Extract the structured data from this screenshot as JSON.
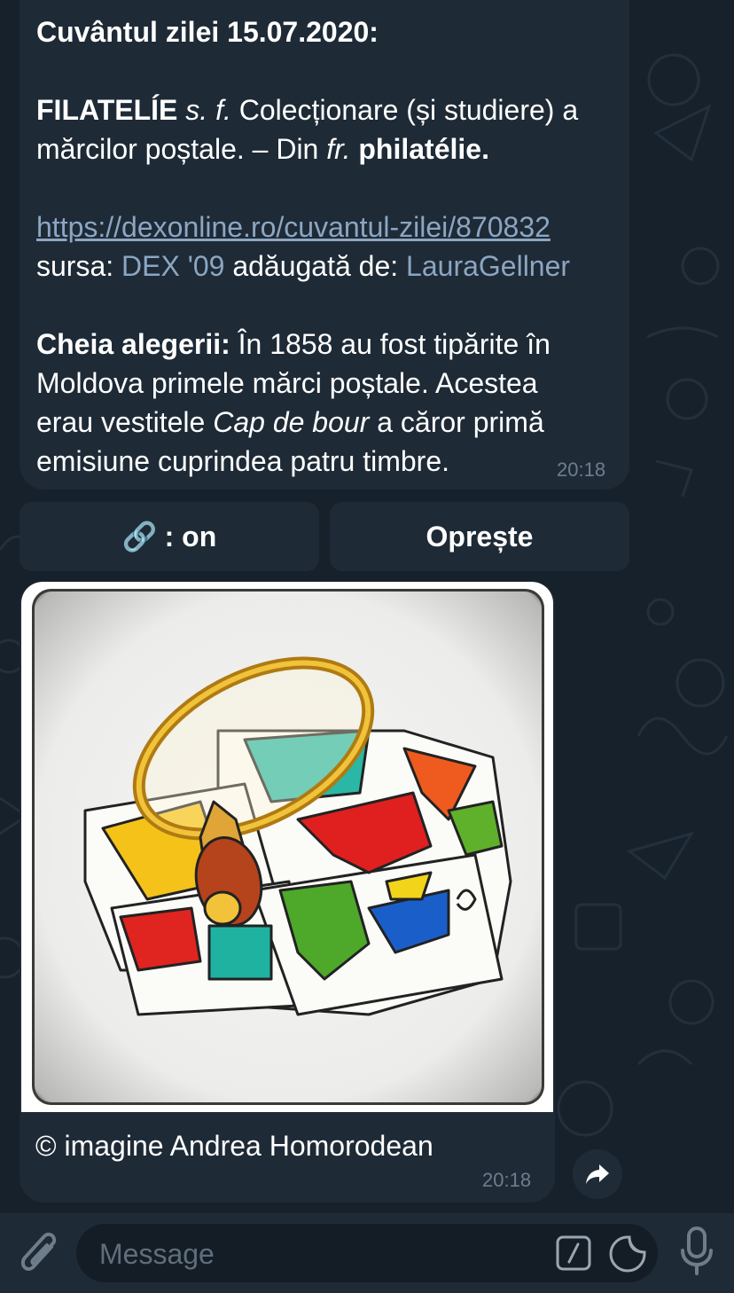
{
  "message": {
    "title": "Cuvântul zilei 15.07.2020:",
    "word": "FILATELÍE",
    "grammar": "s. f.",
    "definition_1": " Colecționare (și studiere) a",
    "definition_2": "mărcilor poștale. – Din ",
    "origin_lang": "fr.",
    "origin_word": "philatélie.",
    "link": "https://dexonline.ro/cuvantul-zilei/870832",
    "source_label": "sursa: ",
    "source_value": "DEX '09",
    "added_label": " adăugată de: ",
    "added_value": "LauraGellner",
    "key_label": "Cheia alegerii:",
    "key_text_1": " În 1858 au fost tipărite în",
    "key_text_2": "Moldova primele mărci poștale. Acestea",
    "key_text_3a": "erau vestitele ",
    "key_text_3b": "Cap de bour",
    "key_text_3c": " a căror primă",
    "key_text_4": "emisiune cuprindea patru timbre.",
    "time": "20:18"
  },
  "keyboard": {
    "link_icon": "🔗",
    "link_label": ": on",
    "stop_label": "Oprește"
  },
  "photo": {
    "caption": "© imagine Andrea Homorodean",
    "time": "20:18"
  },
  "input": {
    "placeholder": "Message"
  },
  "colors": {
    "background": "#17212b",
    "bubble": "#1e2a36",
    "link": "#8ca6c2",
    "timestamp": "#6e7e8e"
  }
}
